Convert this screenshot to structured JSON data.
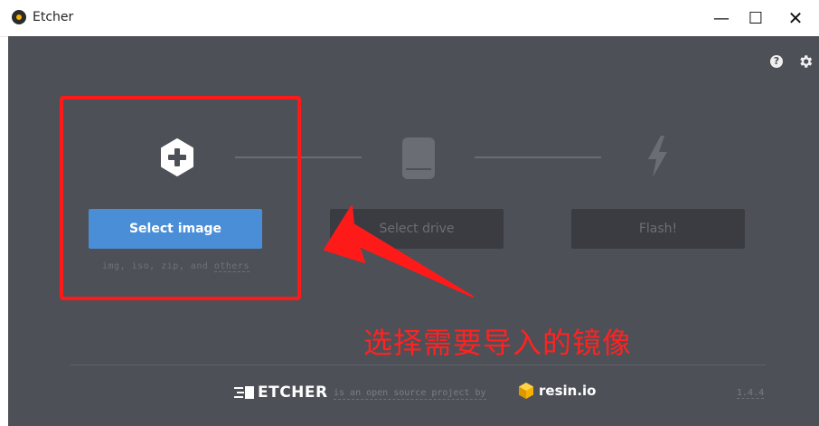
{
  "window": {
    "title": "Etcher",
    "minimize_glyph": "—",
    "maximize_glyph": "☐",
    "close_glyph": "✕"
  },
  "toolbar": {
    "help_icon": "question-circle-icon",
    "settings_icon": "gear-icon"
  },
  "steps": [
    {
      "icon": "plus-hexagon-icon",
      "button_label": "Select image",
      "active": true
    },
    {
      "icon": "drive-icon",
      "button_label": "Select drive",
      "active": false
    },
    {
      "icon": "flash-bolt-icon",
      "button_label": "Flash!",
      "active": false
    }
  ],
  "image_formats": {
    "prefix": "img, iso, zip, and ",
    "link": "others"
  },
  "annotation": {
    "text": "选择需要导入的镜像",
    "color": "#ff2222"
  },
  "footer": {
    "brand": "ETCHER",
    "tagline": "is an open source project by",
    "company": "resin.io",
    "version": "1.4.4"
  },
  "colors": {
    "background": "#4d5056",
    "primary_button": "#4a8ed8",
    "disabled_button": "#3a3c41",
    "accent": "#f5b100"
  }
}
